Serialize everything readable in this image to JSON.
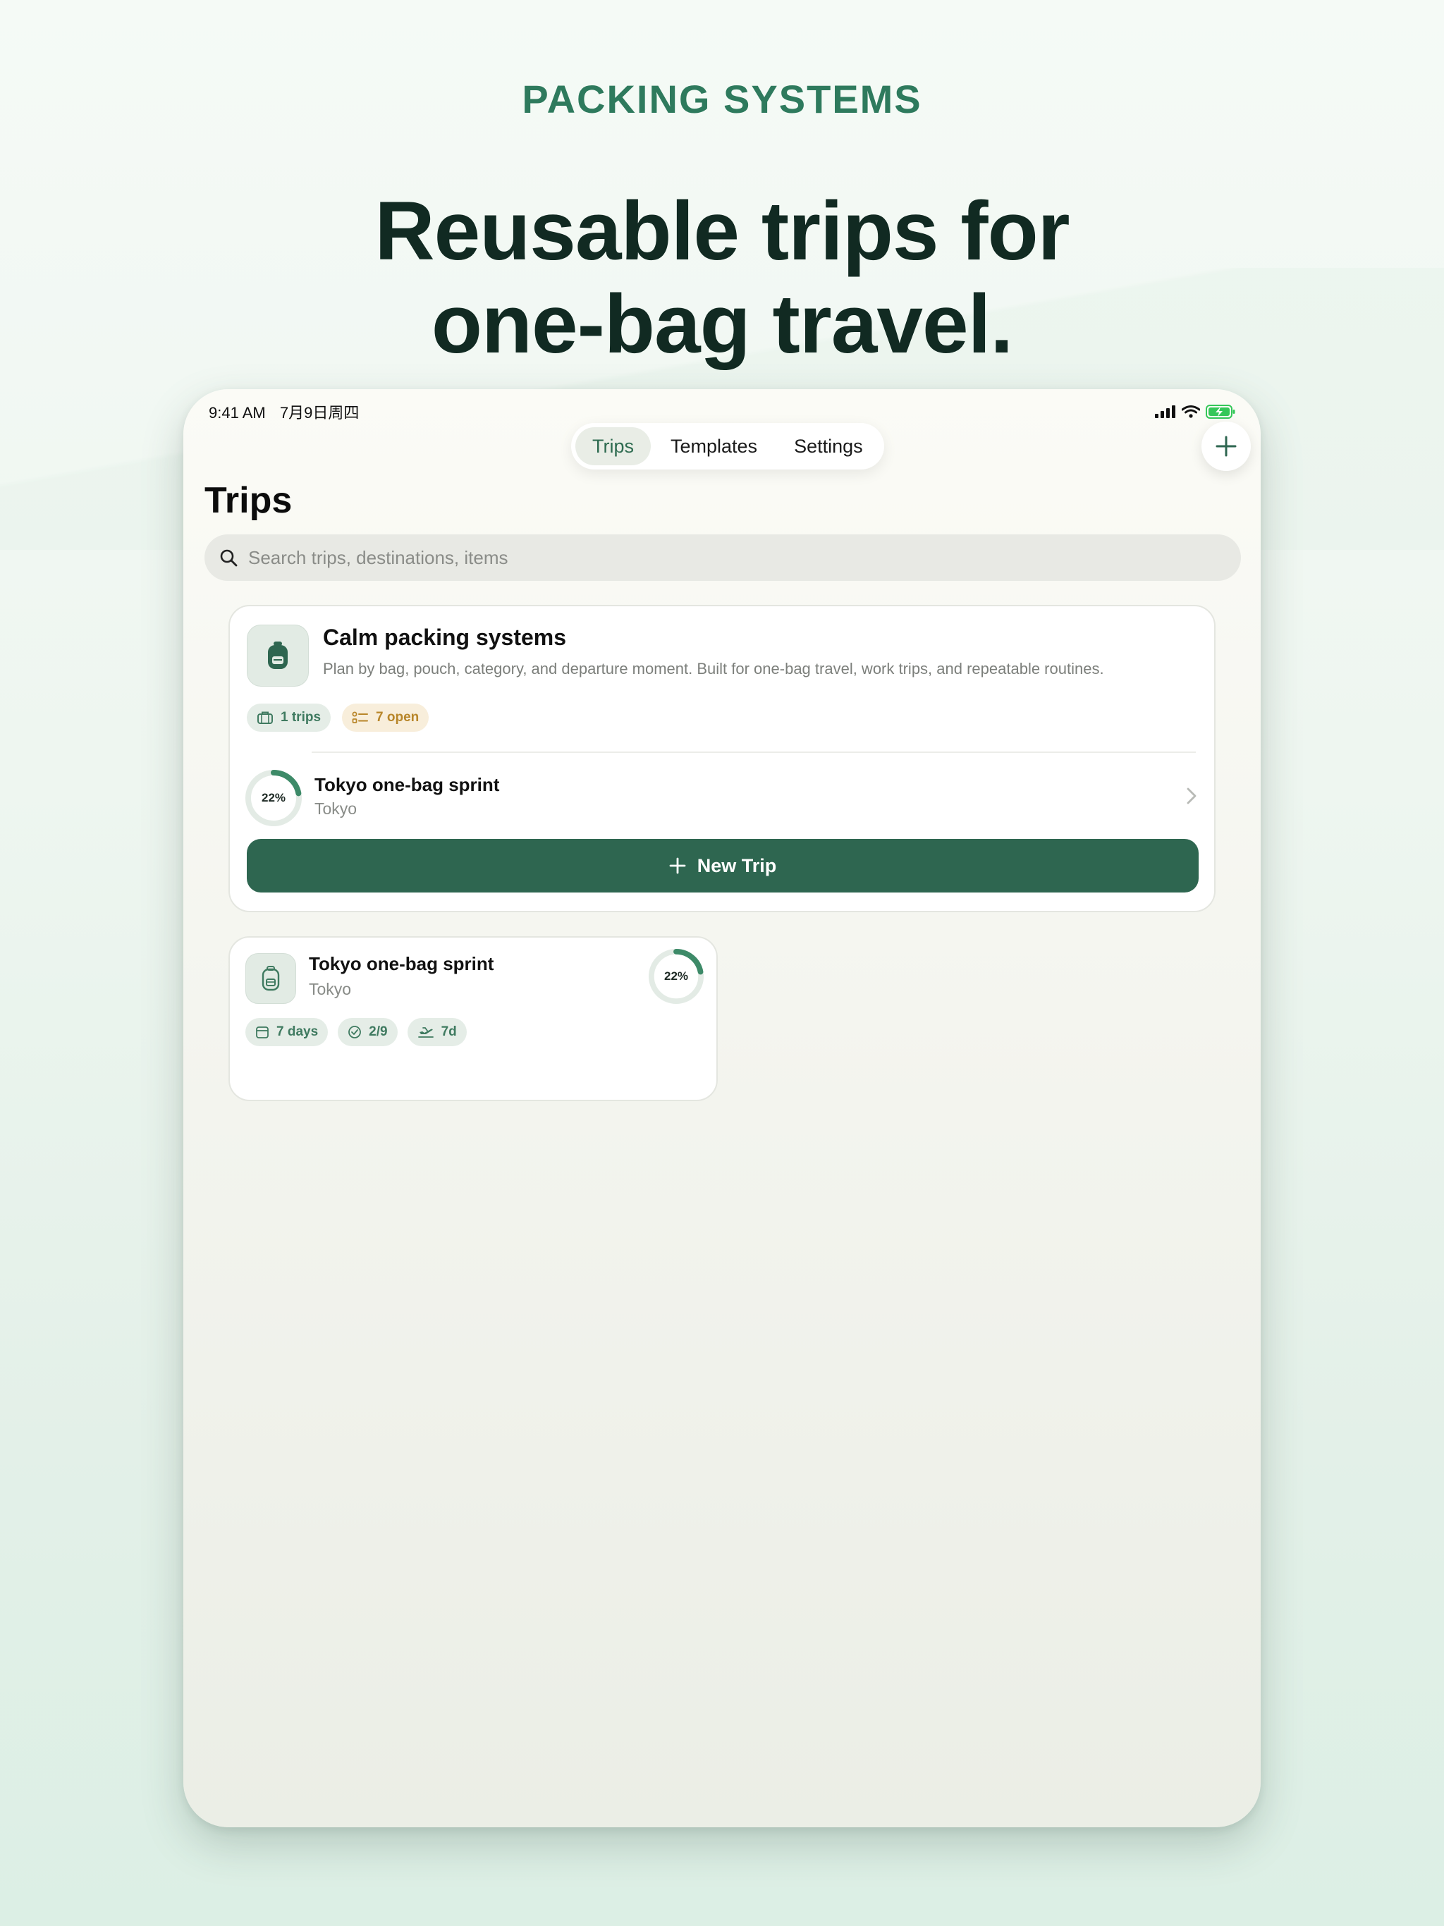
{
  "marketing": {
    "eyebrow": "PACKING SYSTEMS",
    "headline_line1": "Reusable trips for",
    "headline_line2": "one-bag travel."
  },
  "status_bar": {
    "time": "9:41 AM",
    "date": "7月9日周四"
  },
  "tabs": [
    {
      "label": "Trips",
      "active": true
    },
    {
      "label": "Templates",
      "active": false
    },
    {
      "label": "Settings",
      "active": false
    }
  ],
  "page": {
    "title": "Trips"
  },
  "search": {
    "placeholder": "Search trips, destinations, items"
  },
  "summary_card": {
    "title": "Calm packing systems",
    "subtitle": "Plan by bag, pouch, category, and departure moment. Built for one-bag travel, work trips, and repeatable routines.",
    "chips": {
      "trips": "1 trips",
      "open": "7 open"
    },
    "row": {
      "title": "Tokyo one-bag sprint",
      "subtitle": "Tokyo",
      "progress_label": "22%",
      "progress": 0.22
    },
    "new_trip_label": "New Trip"
  },
  "trip_card": {
    "title": "Tokyo one-bag sprint",
    "subtitle": "Tokyo",
    "progress_label": "22%",
    "progress": 0.22,
    "chips": {
      "days": "7 days",
      "packed": "2/9",
      "departure": "7d"
    }
  },
  "colors": {
    "accent": "#2e6650",
    "brand_green": "#2e7a5d",
    "ring_track": "#e3ebe5",
    "ring_fill": "#3d8a68",
    "amber": "#b8862a"
  },
  "icons": {
    "search": "search-icon",
    "add": "plus-icon",
    "backpack": "backpack-icon",
    "suitcase": "suitcase-icon",
    "checklist": "checklist-icon",
    "calendar": "calendar-icon",
    "check_circle": "check-circle-icon",
    "departure": "airplane-departure-icon",
    "chevron": "chevron-right-icon"
  }
}
